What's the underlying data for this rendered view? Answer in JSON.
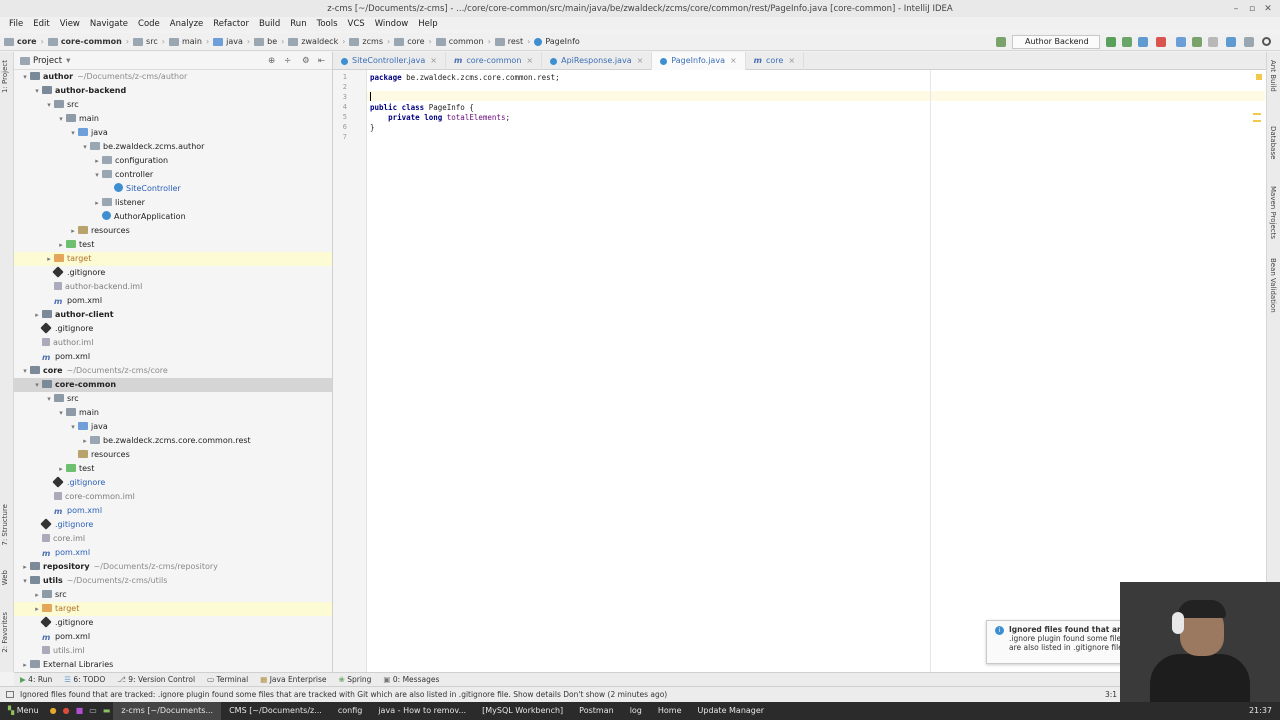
{
  "window": {
    "title": "z-cms [~/Documents/z-cms] - .../core/core-common/src/main/java/be/zwaldeck/zcms/core/common/rest/PageInfo.java [core-common] - IntelliJ IDEA"
  },
  "menu": [
    "File",
    "Edit",
    "View",
    "Navigate",
    "Code",
    "Analyze",
    "Refactor",
    "Build",
    "Run",
    "Tools",
    "VCS",
    "Window",
    "Help"
  ],
  "breadcrumbs": [
    "core",
    "core-common",
    "src",
    "main",
    "java",
    "be",
    "zwaldeck",
    "zcms",
    "core",
    "common",
    "rest",
    "PageInfo"
  ],
  "run_config": "Author Backend",
  "project_panel": {
    "title": "Project"
  },
  "tree": [
    {
      "label": "author",
      "note": "~/Documents/z-cms/author",
      "depth": 0,
      "arrow": "▾",
      "icon": "module",
      "style": "bold"
    },
    {
      "label": "author-backend",
      "depth": 1,
      "arrow": "▾",
      "icon": "module",
      "style": "bold"
    },
    {
      "label": "src",
      "depth": 2,
      "arrow": "▾",
      "icon": "folder"
    },
    {
      "label": "main",
      "depth": 3,
      "arrow": "▾",
      "icon": "folder"
    },
    {
      "label": "java",
      "depth": 4,
      "arrow": "▾",
      "icon": "src"
    },
    {
      "label": "be.zwaldeck.zcms.author",
      "depth": 5,
      "arrow": "▾",
      "icon": "pkg"
    },
    {
      "label": "configuration",
      "depth": 6,
      "arrow": "▸",
      "icon": "pkg"
    },
    {
      "label": "controller",
      "depth": 6,
      "arrow": "▾",
      "icon": "pkg"
    },
    {
      "label": "SiteController",
      "depth": 7,
      "arrow": "",
      "icon": "class",
      "style": "blue"
    },
    {
      "label": "listener",
      "depth": 6,
      "arrow": "▸",
      "icon": "pkg"
    },
    {
      "label": "AuthorApplication",
      "depth": 6,
      "arrow": "",
      "icon": "class"
    },
    {
      "label": "resources",
      "depth": 4,
      "arrow": "▸",
      "icon": "res"
    },
    {
      "label": "test",
      "depth": 3,
      "arrow": "▸",
      "icon": "test"
    },
    {
      "label": "target",
      "depth": 2,
      "arrow": "▸",
      "icon": "target",
      "style": "orange",
      "row": "hl"
    },
    {
      "label": ".gitignore",
      "depth": 2,
      "arrow": "",
      "icon": "git"
    },
    {
      "label": "author-backend.iml",
      "depth": 2,
      "arrow": "",
      "icon": "iml",
      "style": "muted"
    },
    {
      "label": "pom.xml",
      "depth": 2,
      "arrow": "",
      "icon": "pom"
    },
    {
      "label": "author-client",
      "depth": 1,
      "arrow": "▸",
      "icon": "module",
      "style": "bold"
    },
    {
      "label": ".gitignore",
      "depth": 1,
      "arrow": "",
      "icon": "git"
    },
    {
      "label": "author.iml",
      "depth": 1,
      "arrow": "",
      "icon": "iml",
      "style": "muted"
    },
    {
      "label": "pom.xml",
      "depth": 1,
      "arrow": "",
      "icon": "pom"
    },
    {
      "label": "core",
      "note": "~/Documents/z-cms/core",
      "depth": 0,
      "arrow": "▾",
      "icon": "module",
      "style": "bold"
    },
    {
      "label": "core-common",
      "depth": 1,
      "arrow": "▾",
      "icon": "module",
      "style": "bold",
      "row": "sel"
    },
    {
      "label": "src",
      "depth": 2,
      "arrow": "▾",
      "icon": "folder"
    },
    {
      "label": "main",
      "depth": 3,
      "arrow": "▾",
      "icon": "folder"
    },
    {
      "label": "java",
      "depth": 4,
      "arrow": "▾",
      "icon": "src"
    },
    {
      "label": "be.zwaldeck.zcms.core.common.rest",
      "depth": 5,
      "arrow": "▸",
      "icon": "pkg"
    },
    {
      "label": "resources",
      "depth": 4,
      "arrow": "",
      "icon": "res"
    },
    {
      "label": "test",
      "depth": 3,
      "arrow": "▸",
      "icon": "test"
    },
    {
      "label": ".gitignore",
      "depth": 2,
      "arrow": "",
      "icon": "git",
      "style": "blue"
    },
    {
      "label": "core-common.iml",
      "depth": 2,
      "arrow": "",
      "icon": "iml",
      "style": "muted"
    },
    {
      "label": "pom.xml",
      "depth": 2,
      "arrow": "",
      "icon": "pom",
      "style": "blue"
    },
    {
      "label": ".gitignore",
      "depth": 1,
      "arrow": "",
      "icon": "git",
      "style": "blue"
    },
    {
      "label": "core.iml",
      "depth": 1,
      "arrow": "",
      "icon": "iml",
      "style": "muted"
    },
    {
      "label": "pom.xml",
      "depth": 1,
      "arrow": "",
      "icon": "pom",
      "style": "blue"
    },
    {
      "label": "repository",
      "note": "~/Documents/z-cms/repository",
      "depth": 0,
      "arrow": "▸",
      "icon": "module",
      "style": "bold"
    },
    {
      "label": "utils",
      "note": "~/Documents/z-cms/utils",
      "depth": 0,
      "arrow": "▾",
      "icon": "module",
      "style": "bold"
    },
    {
      "label": "src",
      "depth": 1,
      "arrow": "▸",
      "icon": "folder"
    },
    {
      "label": "target",
      "depth": 1,
      "arrow": "▸",
      "icon": "target",
      "style": "orange",
      "row": "hl"
    },
    {
      "label": ".gitignore",
      "depth": 1,
      "arrow": "",
      "icon": "git"
    },
    {
      "label": "pom.xml",
      "depth": 1,
      "arrow": "",
      "icon": "pom"
    },
    {
      "label": "utils.iml",
      "depth": 1,
      "arrow": "",
      "icon": "iml",
      "style": "muted"
    },
    {
      "label": "External Libraries",
      "depth": 0,
      "arrow": "▸",
      "icon": "folder"
    }
  ],
  "tabs": [
    {
      "label": "SiteController.java",
      "active": false
    },
    {
      "label": "core-common",
      "active": false
    },
    {
      "label": "ApiResponse.java",
      "active": false
    },
    {
      "label": "PageInfo.java",
      "active": true
    },
    {
      "label": "core",
      "active": false
    }
  ],
  "code": {
    "line_numbers": [
      "1",
      "2",
      "3",
      "4",
      "5",
      "6",
      "7"
    ],
    "lines": [
      "package be.zwaldeck.zcms.core.common.rest;",
      "",
      "",
      "public class PageInfo {",
      "    private long totalElements;",
      "}",
      ""
    ]
  },
  "left_strip": [
    "1: Project",
    "7: Structure",
    "Web",
    "2: Favorites"
  ],
  "right_strip": [
    "Ant Build",
    "Database",
    "Maven Projects",
    "Bean Validation"
  ],
  "bottom_tools": [
    "4: Run",
    "6: TODO",
    "9: Version Control",
    "Terminal",
    "Java Enterprise",
    "Spring",
    "0: Messages"
  ],
  "status": {
    "message": "Ignored files found that are tracked: .ignore plugin found some files that are tracked with Git which are also listed in .gitignore file. Show details Don't show (2 minutes ago)",
    "position": "3:1"
  },
  "notification": {
    "title": "Ignored files found that are",
    "line1": ".ignore plugin found some file",
    "line2": "are also listed in .gitignore file"
  },
  "taskbar": {
    "menu": "Menu",
    "items": [
      "z-cms [~/Documents...",
      "CMS [~/Documents/z...",
      "config",
      "java - How to remov...",
      "[MySQL Workbench]",
      "Postman",
      "log",
      "Home",
      "Update Manager"
    ],
    "clock": "21:37"
  },
  "colors": {
    "accent": "#3b6fb7",
    "selection": "#d5d5d5",
    "highlight": "#fcfbd4"
  }
}
